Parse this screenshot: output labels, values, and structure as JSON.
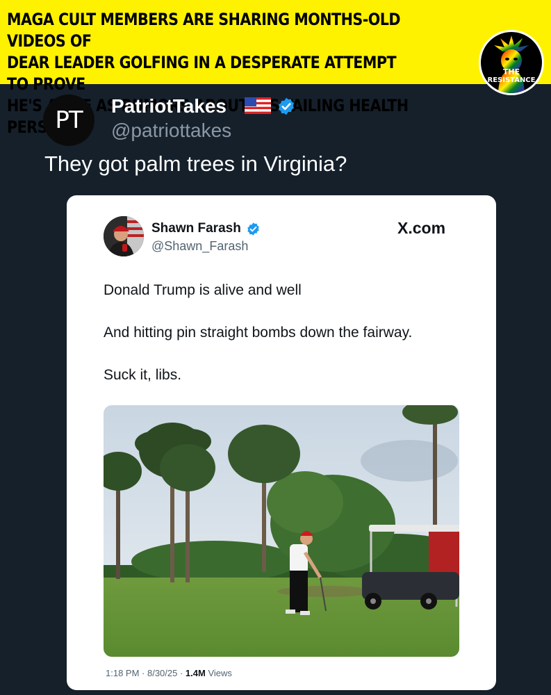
{
  "banner": {
    "headline": "MAGA CULT MEMBERS ARE SHARING MONTHS-OLD VIDEOS OF\nDEAR LEADER GOLFING IN A DESPERATE ATTEMPT TO PROVE\nHE'S ALIVE AS RUMORS ABOUT HIS FAILING HEALTH PERSIST:",
    "logo_line1": "THE",
    "logo_line2": "RESISTANCE"
  },
  "post": {
    "avatar_text": "PT",
    "name": "PatriotTakes",
    "handle": "@patriottakes",
    "text": "They got palm trees in Virginia?",
    "icons": [
      "us-flag-icon",
      "verified-badge-icon"
    ]
  },
  "quoted": {
    "name": "Shawn Farash",
    "handle": "@Shawn_Farash",
    "site": "X.com",
    "lines": [
      "Donald Trump is alive and well",
      "And hitting pin straight bombs down the fairway.",
      "Suck it, libs."
    ],
    "time": "1:18 PM",
    "date": "8/30/25",
    "views_count": "1.4M",
    "views_label": "Views"
  },
  "colors": {
    "background": "#15202b",
    "banner": "#fff200",
    "verified": "#1d9bf0"
  }
}
